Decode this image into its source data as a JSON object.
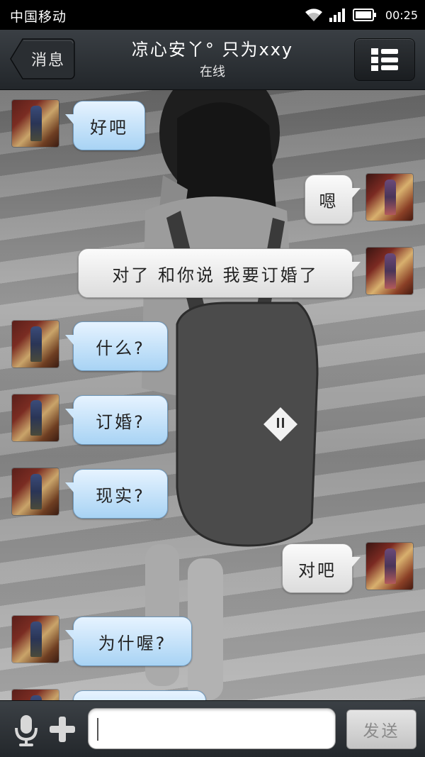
{
  "status_bar": {
    "carrier": "中国移动",
    "time": "00:25"
  },
  "header": {
    "back_label": "消息",
    "title": "凉心安丫° 只为xxy",
    "status": "在线"
  },
  "messages": [
    {
      "side": "in",
      "text": "好吧"
    },
    {
      "side": "out",
      "text": "嗯"
    },
    {
      "side": "out",
      "text": "对了  和你说 我要订婚了"
    },
    {
      "side": "in",
      "text": "什么?"
    },
    {
      "side": "in",
      "text": "订婚?"
    },
    {
      "side": "in",
      "text": "现实?"
    },
    {
      "side": "out",
      "text": "对吧"
    },
    {
      "side": "in",
      "text": "为什喔?"
    }
  ],
  "composer": {
    "input_value": "",
    "send_label": "发送"
  },
  "icons": [
    "wifi-icon",
    "signal-icon",
    "battery-icon",
    "back-arrow-icon",
    "menu-list-icon",
    "mic-icon",
    "plus-icon"
  ]
}
